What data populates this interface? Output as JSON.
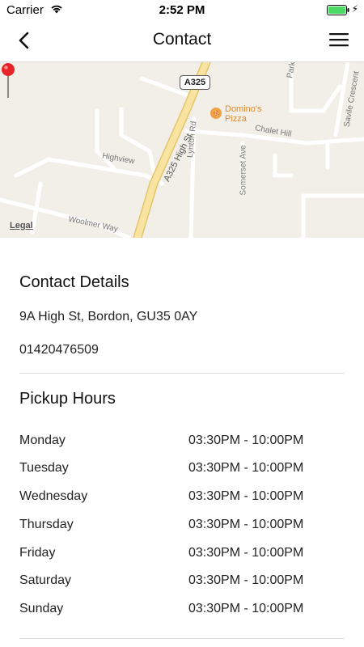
{
  "status_bar": {
    "carrier": "Carrier",
    "time": "2:52 PM",
    "battery_color": "#4cd964"
  },
  "nav": {
    "title": "Contact",
    "back_icon": "chevron-left-icon",
    "menu_icon": "hamburger-menu-icon"
  },
  "map": {
    "road_shield": "A325",
    "poi_name_line1": "Domino's",
    "poi_name_line2": "Pizza",
    "street_high": "A325 High St",
    "street_lynton": "Lynton Rd",
    "street_highview": "Highview",
    "street_woolmer": "Woolmer Way",
    "street_chalet": "Chalet Hill",
    "street_somerset": "Somerset Ave",
    "street_park": "Park",
    "street_savile": "Savile Crescent",
    "legal": "Legal",
    "colors": {
      "land": "#f1efe8",
      "road": "#ffffff",
      "major_road": "#f6d98a",
      "pin": "#e8242b",
      "poi": "#f0a04b"
    }
  },
  "contact": {
    "heading": "Contact Details",
    "address": "9A High St, Bordon, GU35 0AY",
    "phone": "01420476509"
  },
  "pickup": {
    "heading": "Pickup Hours",
    "rows": [
      {
        "day": "Monday",
        "hours": "03:30PM - 10:00PM"
      },
      {
        "day": "Tuesday",
        "hours": "03:30PM - 10:00PM"
      },
      {
        "day": "Wednesday",
        "hours": "03:30PM - 10:00PM"
      },
      {
        "day": "Thursday",
        "hours": "03:30PM - 10:00PM"
      },
      {
        "day": "Friday",
        "hours": "03:30PM - 10:00PM"
      },
      {
        "day": "Saturday",
        "hours": "03:30PM - 10:00PM"
      },
      {
        "day": "Sunday",
        "hours": "03:30PM - 10:00PM"
      }
    ]
  }
}
